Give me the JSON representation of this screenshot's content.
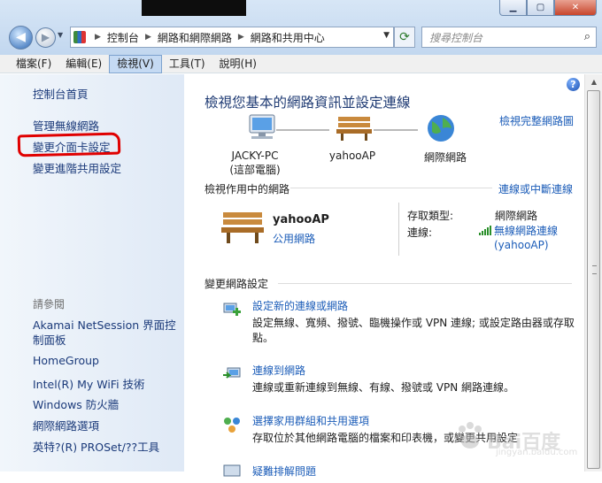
{
  "window": {
    "controls": {
      "minimize": "▁",
      "maximize": "▢",
      "close": "✕"
    }
  },
  "nav": {
    "back": "◀",
    "forward": "▶",
    "dropdown": "▼"
  },
  "address": {
    "crumbs": [
      "控制台",
      "網路和網際網路",
      "網路和共用中心"
    ],
    "refresh_icon": "refresh-icon"
  },
  "search": {
    "placeholder": "搜尋控制台"
  },
  "menu": [
    "檔案(F)",
    "編輯(E)",
    "檢視(V)",
    "工具(T)",
    "說明(H)"
  ],
  "menu_active": "檢視(V)",
  "sidebar": {
    "home": "控制台首頁",
    "links": [
      "管理無線網路",
      "變更介面卡設定",
      "變更進階共用設定"
    ],
    "highlighted": "變更介面卡設定",
    "see_also_label": "請參閱",
    "see_also": [
      "Akamai NetSession 界面控制面板",
      "HomeGroup",
      "Intel(R) My WiFi 技術",
      "Windows 防火牆",
      "網際網路選項",
      "英特?(R) PROSet/??工具"
    ]
  },
  "main": {
    "heading": "檢視您基本的網路資訊並設定連線",
    "full_map": "檢視完整網路圖",
    "nodes": [
      {
        "label": "JACKY-PC",
        "sub": "(這部電腦)"
      },
      {
        "label": "yahooAP",
        "sub": ""
      },
      {
        "label": "網際網路",
        "sub": ""
      }
    ],
    "active_section": "檢視作用中的網路",
    "connect_link": "連線或中斷連線",
    "network": {
      "name": "yahooAP",
      "type": "公用網路",
      "access_label": "存取類型:",
      "access_value": "網際網路",
      "conn_label": "連線:",
      "conn_value": "無線網路連線 (yahooAP)"
    },
    "change_section": "變更網路設定",
    "tasks": [
      {
        "title": "設定新的連線或網路",
        "desc": "設定無線、寬頻、撥號、臨機操作或 VPN 連線; 或設定路由器或存取點。"
      },
      {
        "title": "連線到網路",
        "desc": "連線或重新連線到無線、有線、撥號或 VPN 網路連線。"
      },
      {
        "title": "選擇家用群組和共用選項",
        "desc": "存取位於其他網路電腦的檔案和印表機，或變更共用設定"
      },
      {
        "title": "疑難排解問題",
        "desc": ""
      }
    ]
  },
  "watermark": {
    "text": "Bai百度",
    "sub": "jingyan.baidu.com"
  },
  "colors": {
    "link": "#1b5cb8",
    "heading": "#1e3a73",
    "annotation": "#e00000"
  }
}
